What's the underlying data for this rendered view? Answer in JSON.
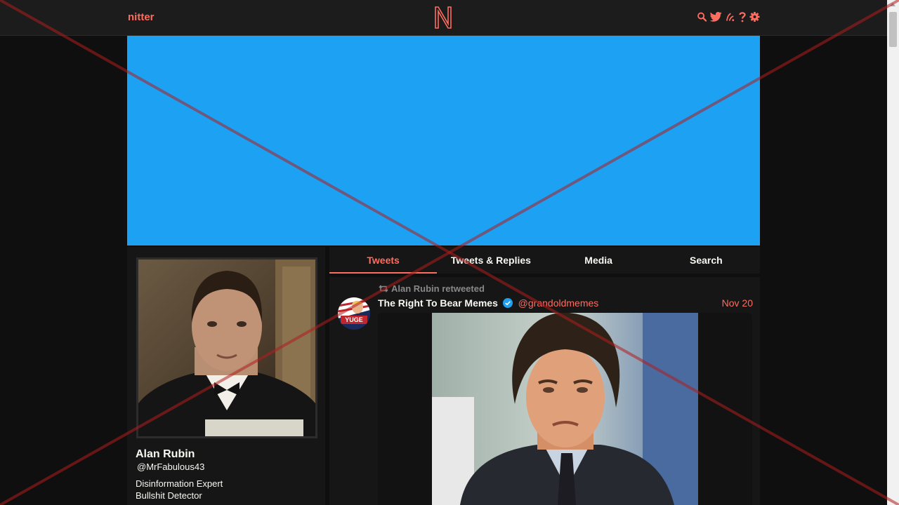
{
  "nav": {
    "brand": "nitter",
    "logo_letter": "N",
    "icons": [
      "search-icon",
      "twitter-bird-icon",
      "rss-icon",
      "help-icon",
      "gear-icon"
    ]
  },
  "colors": {
    "accent": "#ff6c60",
    "banner": "#1da1f2",
    "background": "#0f0f0f",
    "panel": "#161616",
    "verified": "#1da1f2",
    "overlay_x": "#b01e1e"
  },
  "profile": {
    "fullname": "Alan Rubin",
    "username": "@MrFabulous43",
    "bio": [
      "Disinformation Expert",
      "Bullshit Detector"
    ]
  },
  "tabs": [
    {
      "label": "Tweets",
      "active": true
    },
    {
      "label": "Tweets & Replies",
      "active": false
    },
    {
      "label": "Media",
      "active": false
    },
    {
      "label": "Search",
      "active": false
    }
  ],
  "tweet": {
    "retweet_header": "Alan Rubin retweeted",
    "fullname": "The Right To Bear Memes",
    "verified": true,
    "username": "@grandoldmemes",
    "date": "Nov 20",
    "avatar_badge": "YUGE"
  }
}
